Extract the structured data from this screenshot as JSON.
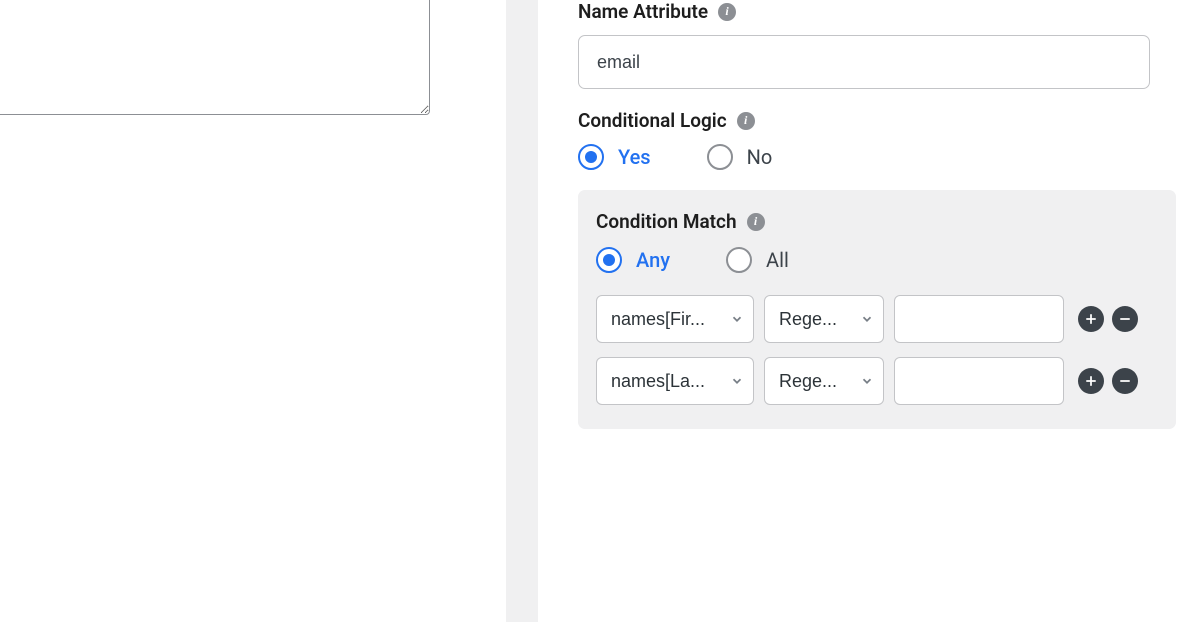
{
  "left": {
    "textarea_value": ""
  },
  "right": {
    "name_attribute": {
      "label": "Name Attribute",
      "value": "email"
    },
    "conditional_logic": {
      "label": "Conditional Logic",
      "options": {
        "yes": "Yes",
        "no": "No"
      },
      "selected": "yes"
    },
    "condition_match": {
      "label": "Condition Match",
      "options": {
        "any": "Any",
        "all": "All"
      },
      "selected": "any",
      "rows": [
        {
          "field": "names[Fir...",
          "operator": "Rege...",
          "value": ""
        },
        {
          "field": "names[La...",
          "operator": "Rege...",
          "value": ""
        }
      ]
    }
  }
}
